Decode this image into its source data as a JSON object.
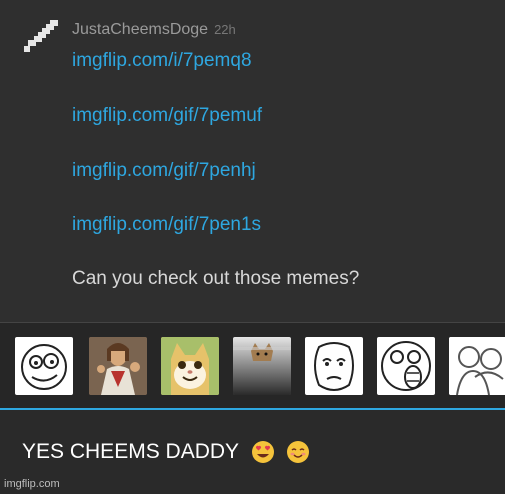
{
  "comment": {
    "username": "JustaCheemsDoge",
    "time": "22h",
    "links": [
      "imgflip.com/i/7pemq8",
      "imgflip.com/gif/7pemuf",
      "imgflip.com/gif/7penhj",
      "imgflip.com/gif/7pen1s"
    ],
    "message": "Can you check out those memes?"
  },
  "meme_strip": {
    "icons": [
      "derp-face-icon",
      "buddy-christ-icon",
      "smiling-cat-icon",
      "ceiling-cat-icon",
      "okay-face-icon",
      "lol-face-icon",
      "friend-hug-icon"
    ]
  },
  "reply": {
    "text": "YES CHEEMS DADDY",
    "emojis": [
      "heart-eyes-emoji-icon",
      "smiling-blush-emoji-icon"
    ]
  },
  "watermark": "imgflip.com",
  "colors": {
    "link": "#2ea7e0",
    "accent": "#2ea7e0",
    "background": "#2f2f2f"
  }
}
